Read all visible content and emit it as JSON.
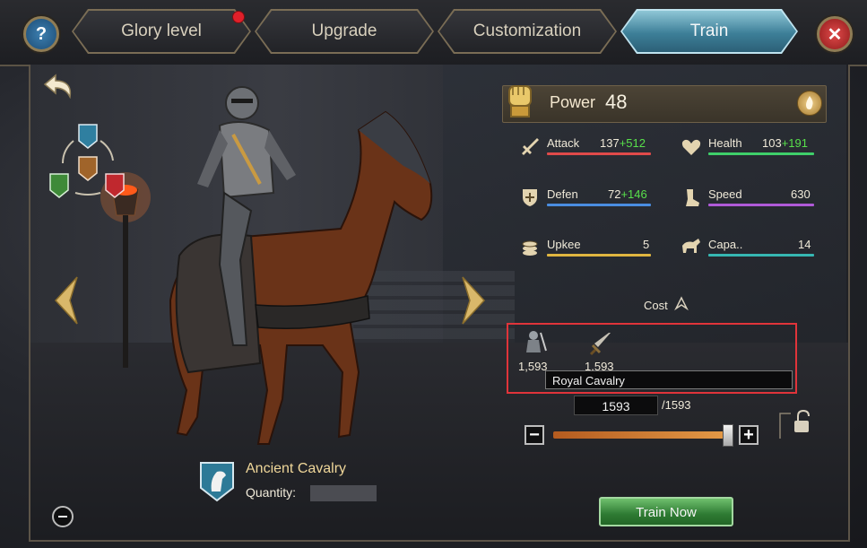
{
  "tabs": [
    {
      "label": "Glory level",
      "has_notification": true
    },
    {
      "label": "Upgrade"
    },
    {
      "label": "Customization"
    },
    {
      "label": "Train",
      "active": true
    }
  ],
  "buttons": {
    "help_icon": "?",
    "close_icon": "✕"
  },
  "power": {
    "label": "Power",
    "value": "48"
  },
  "stats": {
    "attack": {
      "label": "Attack",
      "base": "137",
      "bonus": "+512",
      "color": "#e04a4a"
    },
    "health": {
      "label": "Health",
      "base": "103",
      "bonus": "+191",
      "color": "#3fcf6a"
    },
    "defen": {
      "label": "Defen",
      "base": "72",
      "bonus": "+146",
      "color": "#4a8de0"
    },
    "speed": {
      "label": "Speed",
      "value": "630",
      "color": "#b05ad8"
    },
    "upkee": {
      "label": "Upkee",
      "value": "5",
      "color": "#e0b640"
    },
    "capacity": {
      "label": "Capa..",
      "value": "14",
      "color": "#36b7b2"
    }
  },
  "cost": {
    "label": "Cost",
    "items": [
      {
        "icon": "knight-icon",
        "amount": "1,593"
      },
      {
        "icon": "sword-icon",
        "amount": "1,593"
      }
    ],
    "tooltip": "Royal Cavalry"
  },
  "quantity": {
    "value": "1593",
    "max": "/1593",
    "slider_fraction": 1.0
  },
  "unit": {
    "name": "Ancient Cavalry",
    "quantity_label": "Quantity:"
  },
  "train_button": "Train Now"
}
